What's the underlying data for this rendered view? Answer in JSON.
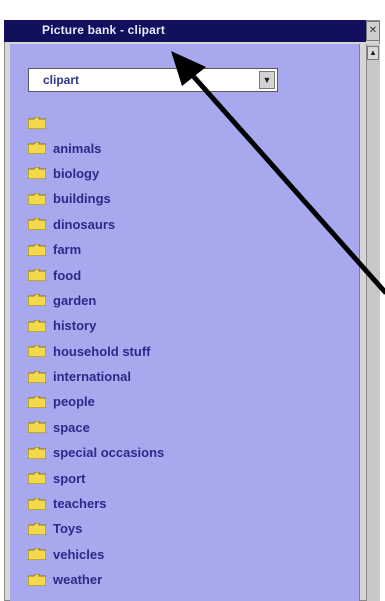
{
  "window": {
    "title": "Picture bank - clipart"
  },
  "dropdown": {
    "selected": "clipart"
  },
  "folders": [
    {
      "label": ""
    },
    {
      "label": "animals"
    },
    {
      "label": "biology"
    },
    {
      "label": "buildings"
    },
    {
      "label": "dinosaurs"
    },
    {
      "label": "farm"
    },
    {
      "label": "food"
    },
    {
      "label": "garden"
    },
    {
      "label": "history"
    },
    {
      "label": "household stuff"
    },
    {
      "label": "international"
    },
    {
      "label": "people"
    },
    {
      "label": "space"
    },
    {
      "label": "special occasions"
    },
    {
      "label": "sport"
    },
    {
      "label": "teachers"
    },
    {
      "label": "Toys"
    },
    {
      "label": "vehicles"
    },
    {
      "label": "weather"
    }
  ],
  "colors": {
    "titlebar": "#10105c",
    "panel": "#a8a8ee",
    "folder": "#f2d84a",
    "arrow": "#000000"
  }
}
